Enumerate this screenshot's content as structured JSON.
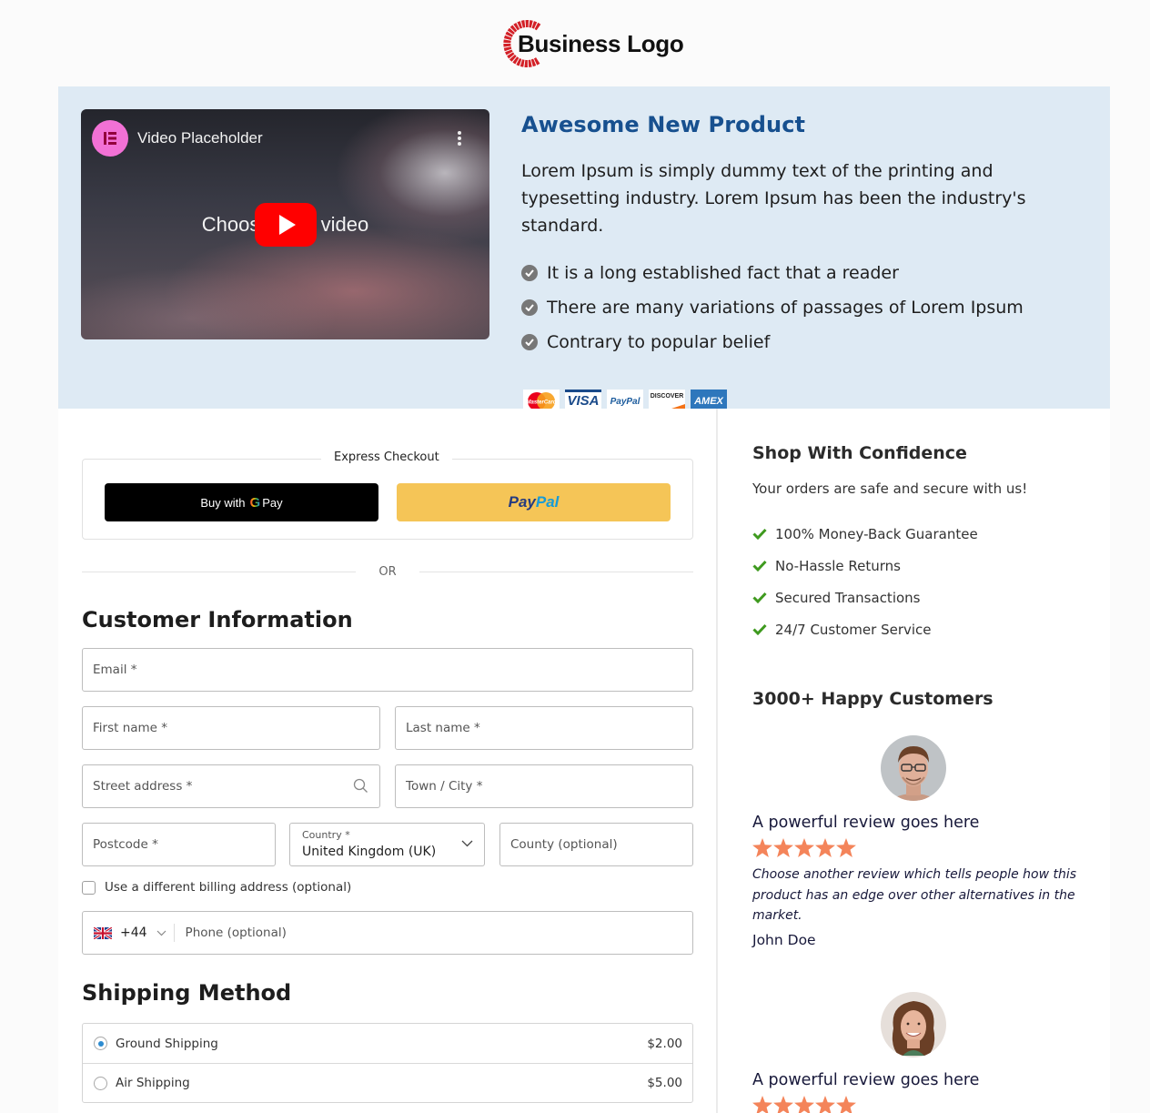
{
  "header": {
    "logo_text": "Business Logo",
    "logo_color": "#d32027"
  },
  "hero": {
    "video": {
      "channel_icon": "elementor-icon",
      "title": "Video Placeholder",
      "overlay_text": "Choose your video",
      "menu_icon": "more-vertical-icon",
      "play_icon": "youtube-play-icon"
    },
    "product_title": "Awesome New Product",
    "product_title_color": "#17508f",
    "description": "Lorem Ipsum is simply dummy text of the printing and typesetting industry. Lorem Ipsum has been the industry's standard.",
    "features": [
      "It is a long established fact that a reader",
      "There are many variations of passages of Lorem Ipsum",
      "Contrary to popular belief"
    ],
    "payment_cards": [
      "MasterCard",
      "VISA",
      "PayPal",
      "DISCOVER",
      "AMEX"
    ]
  },
  "checkout": {
    "express_label": "Express Checkout",
    "gpay_prefix": "Buy with",
    "gpay_g": "G",
    "gpay_suffix": "Pay",
    "paypal_part1": "Pay",
    "paypal_part2": "Pal",
    "or_label": "OR",
    "customer_info_title": "Customer Information",
    "fields": {
      "email": "Email *",
      "first_name": "First name *",
      "last_name": "Last name *",
      "street": "Street address *",
      "town": "Town / City *",
      "postcode": "Postcode *",
      "country_label": "Country *",
      "country_value": "United Kingdom (UK)",
      "county": "County (optional)",
      "phone_code": "+44",
      "phone_placeholder": "Phone (optional)"
    },
    "billing_checkbox_label": "Use a different billing address (optional)",
    "billing_checked": false,
    "shipping_title": "Shipping Method",
    "shipping_options": [
      {
        "label": "Ground Shipping",
        "price": "$2.00",
        "selected": true
      },
      {
        "label": "Air Shipping",
        "price": "$5.00",
        "selected": false
      }
    ]
  },
  "sidebar": {
    "confidence_title": "Shop With Confidence",
    "confidence_sub": "Your orders are safe and secure with us!",
    "trust_items": [
      "100% Money-Back Guarantee",
      "No-Hassle Returns",
      "Secured Transactions",
      "24/7 Customer Service"
    ],
    "customers_title": "3000+ Happy Customers",
    "reviews": [
      {
        "headline": "A powerful review goes here",
        "rating": 5,
        "body": "Choose another review which tells people how this product has an edge over other alternatives in the market.",
        "author": "John Doe"
      },
      {
        "headline": "A powerful review goes here",
        "rating": 5
      }
    ],
    "star_color": "#f4845a",
    "check_color": "#3f9a1f"
  }
}
